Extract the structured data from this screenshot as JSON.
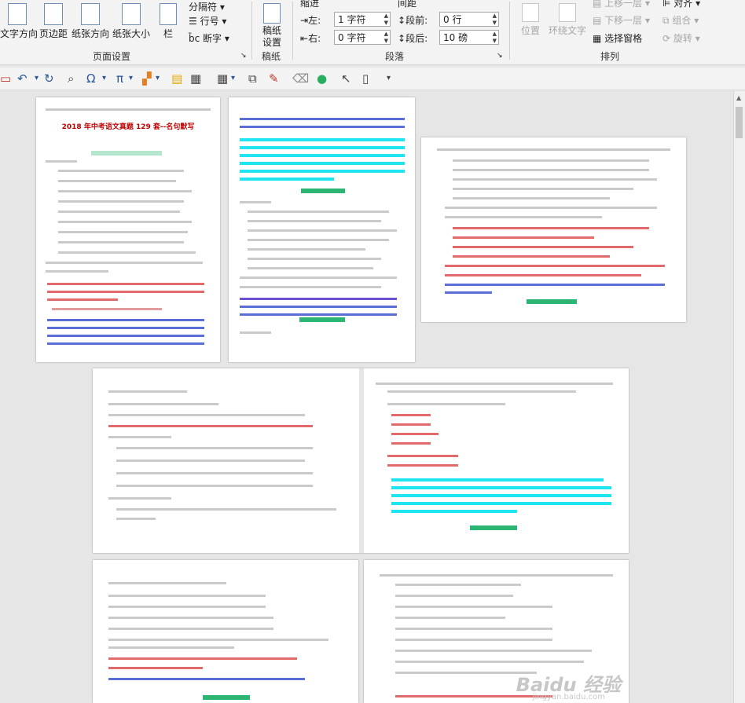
{
  "ribbon": {
    "page_setup": {
      "text_direction": "文字方向",
      "margins": "页边距",
      "orientation": "纸张方向",
      "size": "纸张大小",
      "columns": "栏",
      "breaks": "分隔符",
      "line_numbers": "行号",
      "hyphenation": "断字",
      "group": "页面设置"
    },
    "draft": {
      "label": "稿纸设置",
      "group": "稿纸"
    },
    "paragraph": {
      "indent_title": "缩进",
      "spacing_title": "间距",
      "left_label": "左:",
      "right_label": "右:",
      "left_value": "1 字符",
      "right_value": "0 字符",
      "before_label": "段前:",
      "after_label": "段后:",
      "before_value": "0 行",
      "after_value": "10 磅",
      "group": "段落"
    },
    "arrange": {
      "position": "位置",
      "wrap_text": "环绕文字",
      "bring_forward": "上移一层",
      "send_backward": "下移一层",
      "selection_pane": "选择窗格",
      "align": "对齐",
      "group_btn": "组合",
      "rotate": "旋转",
      "group": "排列"
    }
  },
  "quick_access": {
    "icons": [
      "save-icon",
      "undo-icon",
      "redo-icon",
      "print-preview-icon",
      "omega-symbol-icon",
      "pi-equation-icon",
      "color-fill-icon",
      "doc-icon",
      "table-icon",
      "screenshot-icon",
      "format-painter-icon",
      "clear-format-icon",
      "shape-circle-icon",
      "cursor-icon",
      "new-page-icon",
      "customize-icon"
    ]
  },
  "document": {
    "title": "2018 年中考语文真题 129 套--名句默写",
    "watermark": "Baidu 经验",
    "watermark_url": "jingyan.baidu.com"
  },
  "colors": {
    "highlight": "#1ee5ef",
    "green": "#2bb673",
    "red": "#c00000",
    "accent": "#2b5797"
  }
}
